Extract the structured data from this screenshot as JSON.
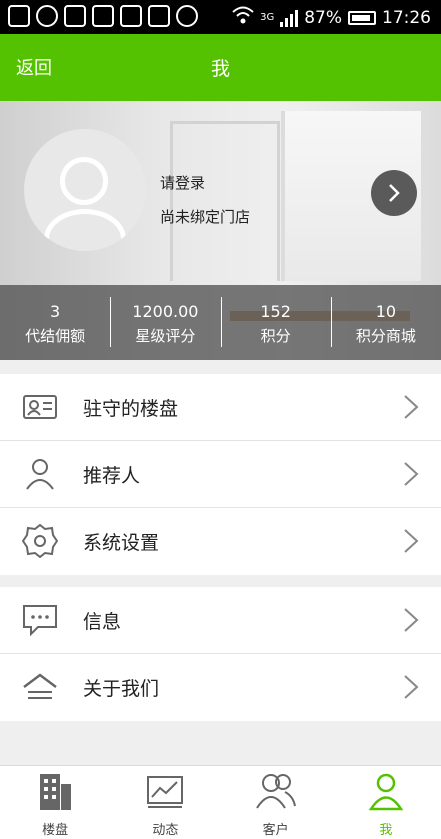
{
  "statusbar": {
    "battery": "87%",
    "time": "17:26",
    "network": "3G"
  },
  "header": {
    "back_label": "返回",
    "title": "我"
  },
  "profile": {
    "login_prompt": "请登录",
    "store_status": "尚未绑定门店",
    "avatar_icon": "user-icon"
  },
  "stats": [
    {
      "value": "3",
      "label": "代结佣额"
    },
    {
      "value": "1200.00",
      "label": "星级评分"
    },
    {
      "value": "152",
      "label": "积分"
    },
    {
      "value": "10",
      "label": "积分商城"
    }
  ],
  "menu_group1": [
    {
      "label": "驻守的楼盘",
      "icon": "id-card-icon"
    },
    {
      "label": "推荐人",
      "icon": "person-icon"
    },
    {
      "label": "系统设置",
      "icon": "gear-icon"
    }
  ],
  "menu_group2": [
    {
      "label": "信息",
      "icon": "message-icon"
    },
    {
      "label": "关于我们",
      "icon": "house-icon"
    }
  ],
  "tabs": [
    {
      "label": "楼盘",
      "icon": "building-icon"
    },
    {
      "label": "动态",
      "icon": "chart-icon"
    },
    {
      "label": "客户",
      "icon": "users-icon"
    },
    {
      "label": "我",
      "icon": "me-icon",
      "active": true
    }
  ],
  "colors": {
    "accent": "#54c200",
    "stats_bg": "#464646"
  }
}
